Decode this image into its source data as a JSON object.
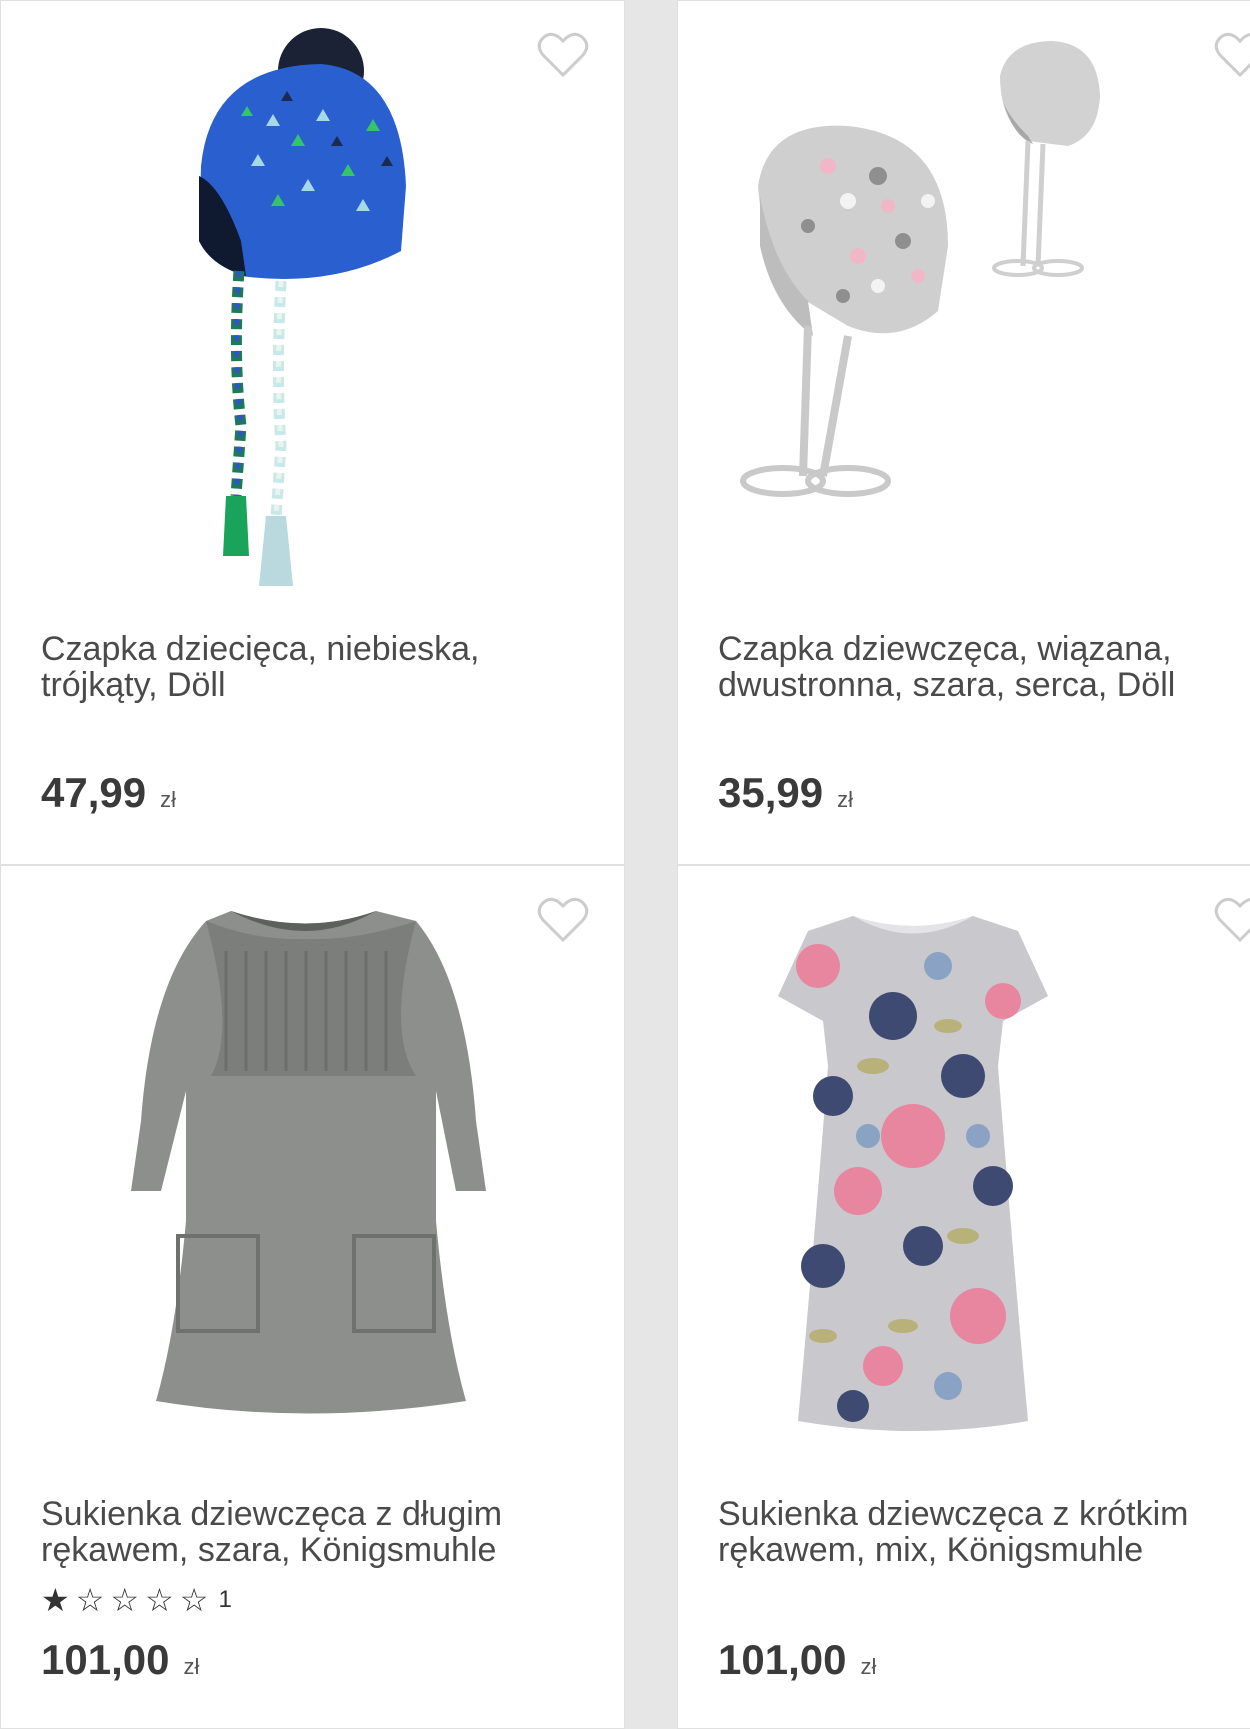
{
  "products": [
    {
      "title": "Czapka dziecięca, niebieska, trójkąty, Döll",
      "price": "47,99",
      "currency": "zł",
      "image_icon": "blue-kids-hat-image"
    },
    {
      "title": "Czapka dziewczęca, wiązana, dwustronna, szara, serca, Döll",
      "price": "35,99",
      "currency": "zł",
      "image_icon": "grey-hearts-hat-image"
    },
    {
      "title": "Sukienka dziewczęca z długim rękawem, szara, Königsmuhle",
      "price": "101,00",
      "currency": "zł",
      "rating": 1,
      "rating_max": 5,
      "rating_count": "1",
      "image_icon": "grey-knit-dress-image"
    },
    {
      "title": "Sukienka dziewczęca z krótkim rękawem, mix, Königsmuhle",
      "price": "101,00",
      "currency": "zł",
      "image_icon": "floral-dress-image"
    }
  ],
  "colors": {
    "background": "#e6e6e6",
    "card": "#ffffff",
    "text": "#4a4a4a",
    "heart": "#cccccc"
  }
}
